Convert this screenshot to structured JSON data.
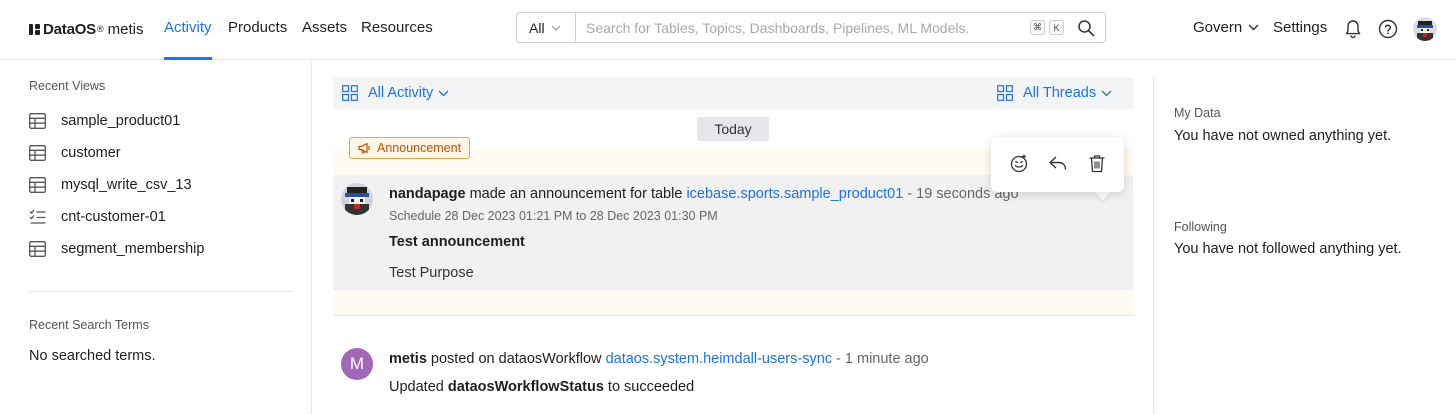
{
  "brand": {
    "name": "DataOS",
    "reg": "®",
    "product": "metis"
  },
  "nav": {
    "items": [
      {
        "label": "Activity",
        "active": true
      },
      {
        "label": "Products",
        "active": false
      },
      {
        "label": "Assets",
        "active": false
      },
      {
        "label": "Resources",
        "active": false
      }
    ],
    "accent": "#1a73e8"
  },
  "search": {
    "scope": "All",
    "placeholder": "Search for Tables, Topics, Dashboards, Pipelines, ML Models.",
    "value": "",
    "shortcut": [
      "⌘",
      "K"
    ]
  },
  "header_right": {
    "govern": "Govern",
    "settings": "Settings",
    "icons": [
      "bell-icon",
      "help-icon",
      "user-avatar"
    ]
  },
  "sidebar": {
    "recent_views_heading": "Recent Views",
    "recent_views": [
      {
        "label": "sample_product01",
        "icon": "table-icon"
      },
      {
        "label": "customer",
        "icon": "table-icon"
      },
      {
        "label": "mysql_write_csv_13",
        "icon": "table-icon"
      },
      {
        "label": "cnt-customer-01",
        "icon": "checklist-icon"
      },
      {
        "label": "segment_membership",
        "icon": "table-icon"
      }
    ],
    "recent_search_heading": "Recent Search Terms",
    "recent_search_empty": "No searched terms."
  },
  "feed": {
    "filter_left": "All Activity",
    "filter_right": "All Threads",
    "date_divider": "Today",
    "announcement": {
      "badge": "Announcement",
      "user": "nandapage",
      "action": "made an announcement for table",
      "entity": "icebase.sports.sample_product01",
      "time": "- 19 seconds ago",
      "schedule": "Schedule 28 Dec 2023 01:21 PM to 28 Dec 2023 01:30 PM",
      "title": "Test announcement",
      "description": "Test Purpose",
      "badge_color": "#e8a845"
    },
    "popover_actions": [
      "reaction-icon",
      "reply-icon",
      "delete-icon"
    ],
    "post": {
      "avatar_letter": "M",
      "user": "metis",
      "action": "posted on dataosWorkflow",
      "entity": "dataos.system.heimdall-users-sync",
      "time": "- 1 minute ago",
      "message_prefix": "Updated",
      "message_field": "dataosWorkflowStatus",
      "message_suffix": "to succeeded",
      "avatar_color": "#a068b6"
    }
  },
  "right_panel": {
    "my_data_label": "My Data",
    "my_data_text": "You have not owned anything yet.",
    "following_label": "Following",
    "following_text": "You have not followed anything yet."
  }
}
